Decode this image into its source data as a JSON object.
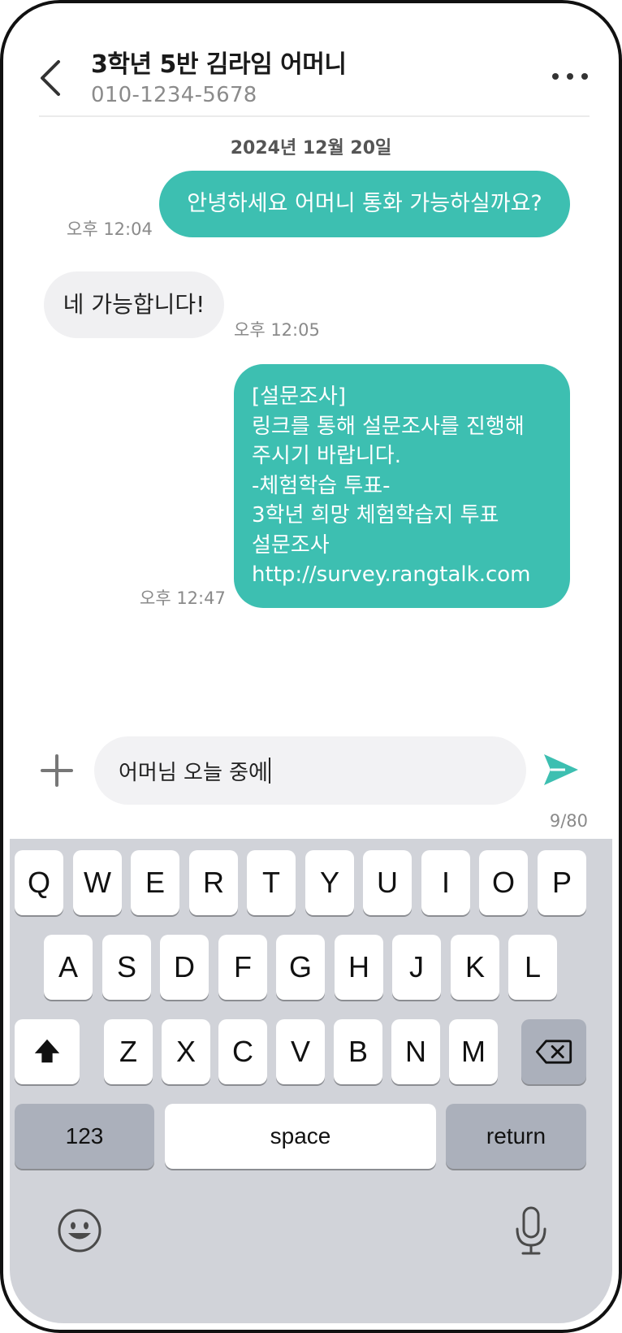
{
  "header": {
    "contact_name": "3학년 5반 김라임 어머니",
    "contact_phone": "010-1234-5678"
  },
  "conversation": {
    "date": "2024년 12월 20일",
    "messages": [
      {
        "direction": "outgoing",
        "text": "안녕하세요 어머니 통화 가능하실까요?",
        "time": "오후 12:04"
      },
      {
        "direction": "incoming",
        "text": "네 가능합니다!",
        "time": "오후 12:05"
      },
      {
        "direction": "outgoing",
        "lines": [
          "[설문조사]",
          "링크를 통해 설문조사를 진행해",
          "주시기 바랍니다.",
          "-체험학습 투표-",
          "3학년 희망 체험학습지 투표",
          "설문조사",
          "http://survey.rangtalk.com"
        ],
        "time": "오후 12:47"
      }
    ]
  },
  "composer": {
    "value": "어머님 오늘 중에",
    "char_count": "9/80"
  },
  "keyboard": {
    "row1": [
      "Q",
      "W",
      "E",
      "R",
      "T",
      "Y",
      "U",
      "I",
      "O",
      "P"
    ],
    "row2": [
      "A",
      "S",
      "D",
      "F",
      "G",
      "H",
      "J",
      "K",
      "L"
    ],
    "row3": [
      "Z",
      "X",
      "C",
      "V",
      "B",
      "N",
      "M"
    ],
    "numbers_label": "123",
    "space_label": "space",
    "return_label": "return"
  },
  "colors": {
    "outgoing_bubble": "#3dbfb1",
    "incoming_bubble": "#f0f0f2",
    "send_icon": "#3dbfb1",
    "keyboard_bg": "#d1d3d9"
  },
  "icons": [
    "back-chevron-icon",
    "more-dots-icon",
    "plus-icon",
    "send-icon",
    "shift-icon",
    "backspace-icon",
    "emoji-icon",
    "microphone-icon"
  ]
}
